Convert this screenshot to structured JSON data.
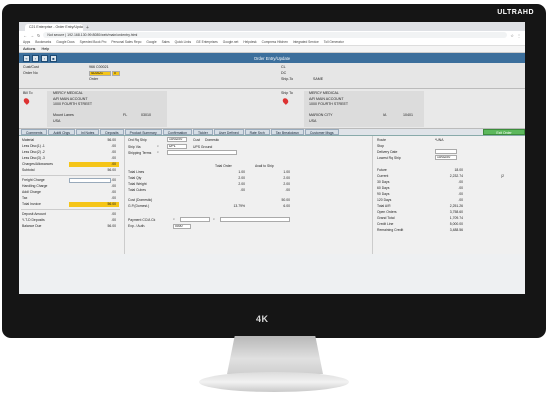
{
  "brand": "ULTRAHD",
  "badge": "4K",
  "browser": {
    "tab_title": "C21 Enterprise - Order Entry/Update",
    "newtab": "+",
    "url": "Not secure | 192.168.130.99:8080/web/main/ordentry.html",
    "bookmarks": [
      "Apps",
      "Bookmarks",
      "Google Docs",
      "Speeded Book Pro",
      "Personal Sales Repo",
      "Google",
      "Sales",
      "Quick Links",
      "GE Enterprises",
      "Google.net",
      "Helpdesk",
      "Compress Hitchen",
      "Integrated Service",
      "Toll Generator"
    ]
  },
  "menu": [
    "Actions",
    "Help"
  ],
  "app_title": "Order Entry/Update",
  "header": {
    "cust_code_label": "Cust/Cust",
    "cust_code_value": "966 C00021",
    "order_no_label": "Order No",
    "order_no_value": "4C0021",
    "order_suffix": "0",
    "order_field": "Order",
    "cl_label": "CL",
    "dc_label": "DC",
    "ship_to_label": "Ship-To",
    "ship_to_value": "SAME"
  },
  "bill_to": {
    "label": "Bill To",
    "name": "MERCY MEDICAL",
    "line1": "A/R MAIN ACCOUNT",
    "line2": "1000 FOURTH STREET",
    "city": "Mount Lanes",
    "state": "FL",
    "zip": "03010",
    "country": "USA"
  },
  "ship_to": {
    "label": "Ship To",
    "name": "MERCY MEDICAL",
    "line1": "A/R MAIN ACCOUNT",
    "line2": "1000 FOURTH STREET",
    "city": "MARION CITY",
    "state": "IA",
    "zip": "10401",
    "country": "USA"
  },
  "tabs": [
    "Comments",
    "Addtl Chgs",
    "Inl Notes",
    "Deposits",
    "Product Summary",
    "Confirmation",
    "Tickler",
    "User Defined",
    "Rate Srch",
    "Tax Breakdown",
    "Customer Msgs",
    "Exit Order"
  ],
  "totals": {
    "rows": [
      {
        "label": "Material",
        "value": "56.00"
      },
      {
        "label": "Less Disc(1) -1",
        "value": ".00"
      },
      {
        "label": "Less Disc(2) -2",
        "value": ".00"
      },
      {
        "label": "Less Disc(3) -3",
        "value": ".00"
      },
      {
        "label": "Charges/Allowances",
        "value": ".00"
      },
      {
        "label": "Subtotal",
        "value": "56.00"
      }
    ],
    "rows2": [
      {
        "label": "Freight Charge",
        "value": ".00"
      },
      {
        "label": "Handling Charge",
        "value": ".00"
      },
      {
        "label": "Addl Charge",
        "value": ".00"
      },
      {
        "label": "Tax",
        "value": ".00"
      },
      {
        "label": "Total Invoice",
        "value": "56.00"
      }
    ],
    "rows3": [
      {
        "label": "Deposit Amount",
        "value": ".00"
      },
      {
        "label": "Y-T-D Deposits",
        "value": ".00"
      },
      {
        "label": "Balance Due",
        "value": "56.00"
      }
    ]
  },
  "ship": {
    "ord_ship_label": "Ord Rq Ship",
    "ord_ship_value": "10/02/20",
    "cust_label": "Cust",
    "cust_value": "Domestic",
    "ship_via_label": "Ship Via",
    "ship_via_value": "UP1",
    "ship_via_desc": "UPS Ground",
    "ship_terms_label": "Shipping Terms"
  },
  "grid": {
    "col1": "Total Order",
    "col2": "Avail to Ship",
    "rows": [
      {
        "label": "Total Lines",
        "a": "1.00",
        "b": "1.00"
      },
      {
        "label": "Total Qty",
        "a": "2.00",
        "b": "2.00"
      },
      {
        "label": "Total Weight",
        "a": "2.00",
        "b": "2.00"
      },
      {
        "label": "Total Cubes",
        "a": ".00",
        "b": ".00"
      }
    ]
  },
  "gp": {
    "cost_label": "Cost (Domestic)",
    "cost_value": "50.00",
    "gp_label": "G.P.(Domest.)",
    "gp_pct": "13.79%",
    "gp_value": "6.00"
  },
  "pay": {
    "label": "Payment CC/A Ck",
    "exp_label": "Exp. / Auth.",
    "exp_value": "0000"
  },
  "route": {
    "route_label": "Route",
    "route_value": "*UNA",
    "stop_label": "Stop",
    "delivery_label": "Delivery Date",
    "lowest_label": "Lowest Rq Ship",
    "lowest_value": "10/02/20"
  },
  "aging": {
    "rows": [
      {
        "label": "Future",
        "value": "18.00"
      },
      {
        "label": "Current",
        "value": "2,232.74"
      },
      {
        "label": "30 Days",
        "value": ".00"
      },
      {
        "label": "60 Days",
        "value": ".00"
      },
      {
        "label": "90 Days",
        "value": ".00"
      },
      {
        "label": "120 Days",
        "value": ".00"
      },
      {
        "label": "Total A/R",
        "value": "2,251.26"
      },
      {
        "label": "Open Orders",
        "value": "3,758.60"
      },
      {
        "label": "Grand Total",
        "value": "1,709.74"
      },
      {
        "label": "Credit Line",
        "value": "5,000.00"
      },
      {
        "label": "Remaining Credit",
        "value": "3,488.56"
      }
    ],
    "side_value": "(2"
  }
}
